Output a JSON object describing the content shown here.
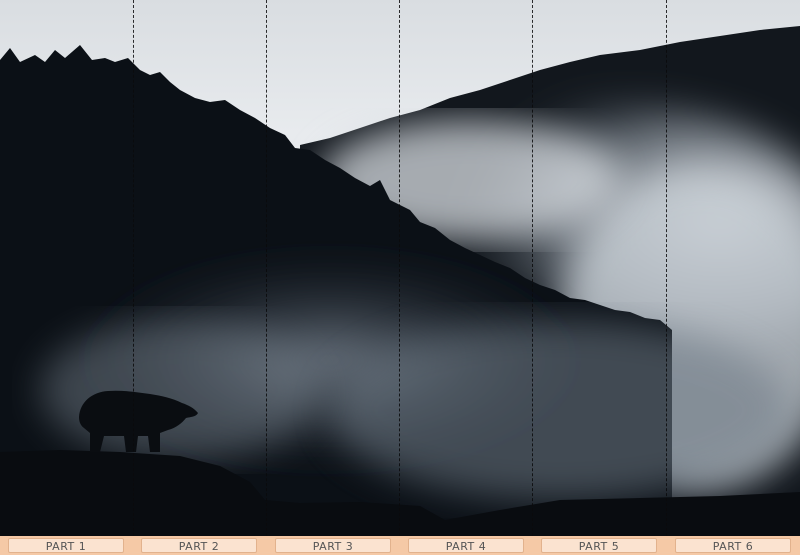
{
  "parts": [
    {
      "label": "PART 1"
    },
    {
      "label": "PART 2"
    },
    {
      "label": "PART 3"
    },
    {
      "label": "PART 4"
    },
    {
      "label": "PART 5"
    },
    {
      "label": "PART 6"
    }
  ],
  "scene": {
    "subject": "bear-silhouette",
    "background": "misty-forested-mountains"
  },
  "colors": {
    "footer": "#f5c9a6",
    "label_bg": "#fbe3d0",
    "label_text": "#555555",
    "sky": "#e4e8ec",
    "forest": "#0c1117"
  }
}
